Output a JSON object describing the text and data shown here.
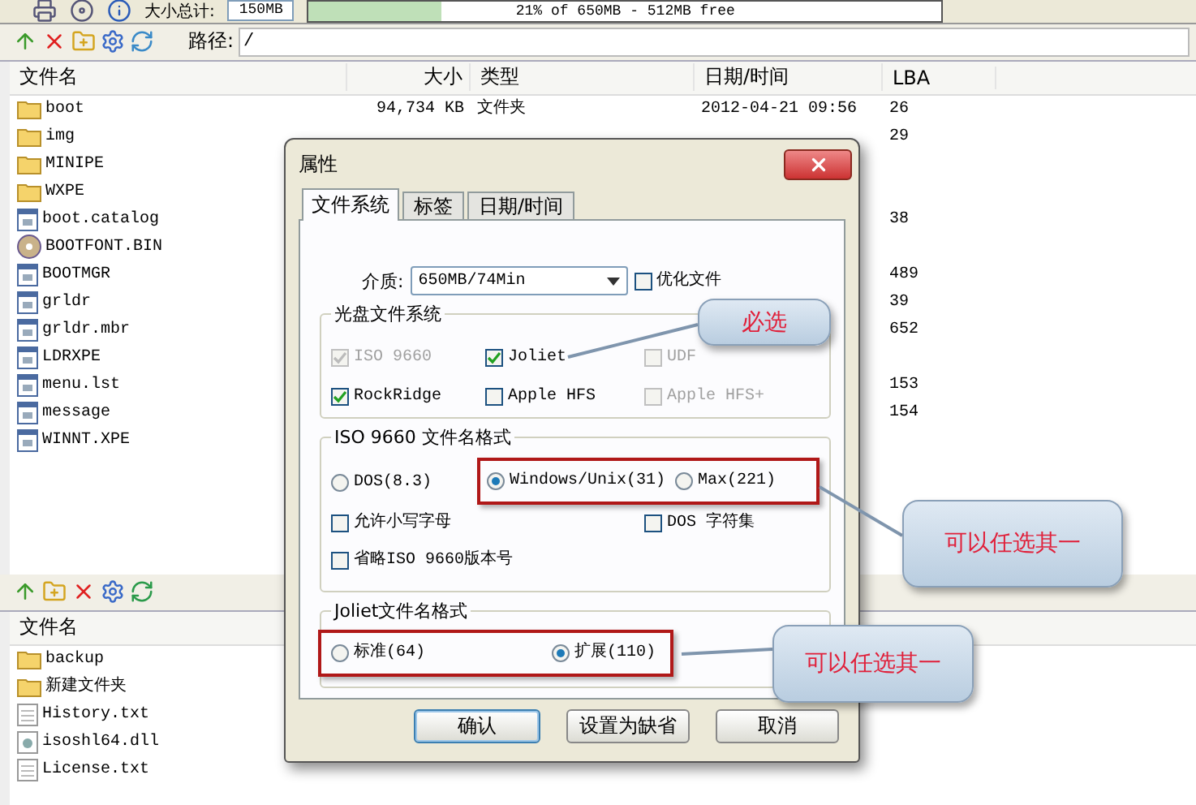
{
  "top_toolbar": {
    "total_label": "大小总计:",
    "total_value": "150MB",
    "capacity": "21% of 650MB - 512MB free",
    "level": 0.21
  },
  "path_bar": {
    "label": "路径:",
    "value": "/"
  },
  "iso_list": {
    "columns": [
      "文件名",
      "大小",
      "类型",
      "日期/时间",
      "LBA"
    ],
    "rows": [
      {
        "kind": "folder",
        "name": "boot",
        "size": "94,734 KB",
        "type": "文件夹",
        "date": "2012-04-21 09:56",
        "lba": "26"
      },
      {
        "kind": "folder",
        "name": "img",
        "lba": "29"
      },
      {
        "kind": "folder",
        "name": "MINIPE"
      },
      {
        "kind": "folder",
        "name": "WXPE"
      },
      {
        "kind": "file",
        "name": "boot.catalog",
        "lba": "38"
      },
      {
        "kind": "disc",
        "name": "BOOTFONT.BIN"
      },
      {
        "kind": "file",
        "name": "BOOTMGR",
        "lba": "489"
      },
      {
        "kind": "file",
        "name": "grldr",
        "lba": "39"
      },
      {
        "kind": "file",
        "name": "grldr.mbr",
        "lba": "652"
      },
      {
        "kind": "file",
        "name": "LDRXPE"
      },
      {
        "kind": "file",
        "name": "menu.lst",
        "lba": "153"
      },
      {
        "kind": "file",
        "name": "message",
        "lba": "154"
      },
      {
        "kind": "file",
        "name": "WINNT.XPE"
      }
    ]
  },
  "local_list": {
    "columns": [
      "文件名"
    ],
    "rows": [
      {
        "kind": "folder",
        "name": "backup"
      },
      {
        "kind": "folder",
        "name": "新建文件夹"
      },
      {
        "kind": "text",
        "name": "History.txt"
      },
      {
        "kind": "dll",
        "name": "isoshl64.dll"
      },
      {
        "kind": "text",
        "name": "License.txt"
      }
    ]
  },
  "dialog": {
    "title": "属性",
    "tabs": [
      {
        "label": "文件系统",
        "selected": true
      },
      {
        "label": "标签",
        "selected": false
      },
      {
        "label": "日期/时间",
        "selected": false
      }
    ],
    "media_label": "介质:",
    "media_value": "650MB/74Min",
    "optimize": {
      "label": "优化文件",
      "checked": false,
      "disabled": false
    },
    "fs_group": {
      "title": "光盘文件系统",
      "options": [
        {
          "label": "ISO 9660",
          "checked": true,
          "disabled": true
        },
        {
          "label": "Joliet",
          "checked": true,
          "disabled": false
        },
        {
          "label": "UDF",
          "checked": false,
          "disabled": true
        },
        {
          "label": "RockRidge",
          "checked": true,
          "disabled": false
        },
        {
          "label": "Apple HFS",
          "checked": false,
          "disabled": false
        },
        {
          "label": "Apple HFS+",
          "checked": false,
          "disabled": true
        }
      ]
    },
    "iso_group": {
      "title": "ISO 9660 文件名格式",
      "radios": [
        {
          "label": "DOS(8.3)",
          "selected": false
        },
        {
          "label": "Windows/Unix(31)",
          "selected": true
        },
        {
          "label": "Max(221)",
          "selected": false
        }
      ],
      "options": [
        {
          "label": "允许小写字母",
          "checked": false,
          "disabled": false
        },
        {
          "label": "DOS 字符集",
          "checked": false,
          "disabled": false
        },
        {
          "label": "省略ISO 9660版本号",
          "checked": false,
          "disabled": false
        }
      ]
    },
    "joliet_group": {
      "title": "Joliet文件名格式",
      "radios": [
        {
          "label": "标准(64)",
          "selected": false
        },
        {
          "label": "扩展(110)",
          "selected": true
        }
      ]
    },
    "buttons": [
      {
        "label": "确认",
        "default": true
      },
      {
        "label": "设置为缺省",
        "default": false
      },
      {
        "label": "取消",
        "default": false
      }
    ]
  },
  "callouts": [
    {
      "text": "必选"
    },
    {
      "text": "可以任选其一"
    },
    {
      "text": "可以任选其一"
    }
  ]
}
